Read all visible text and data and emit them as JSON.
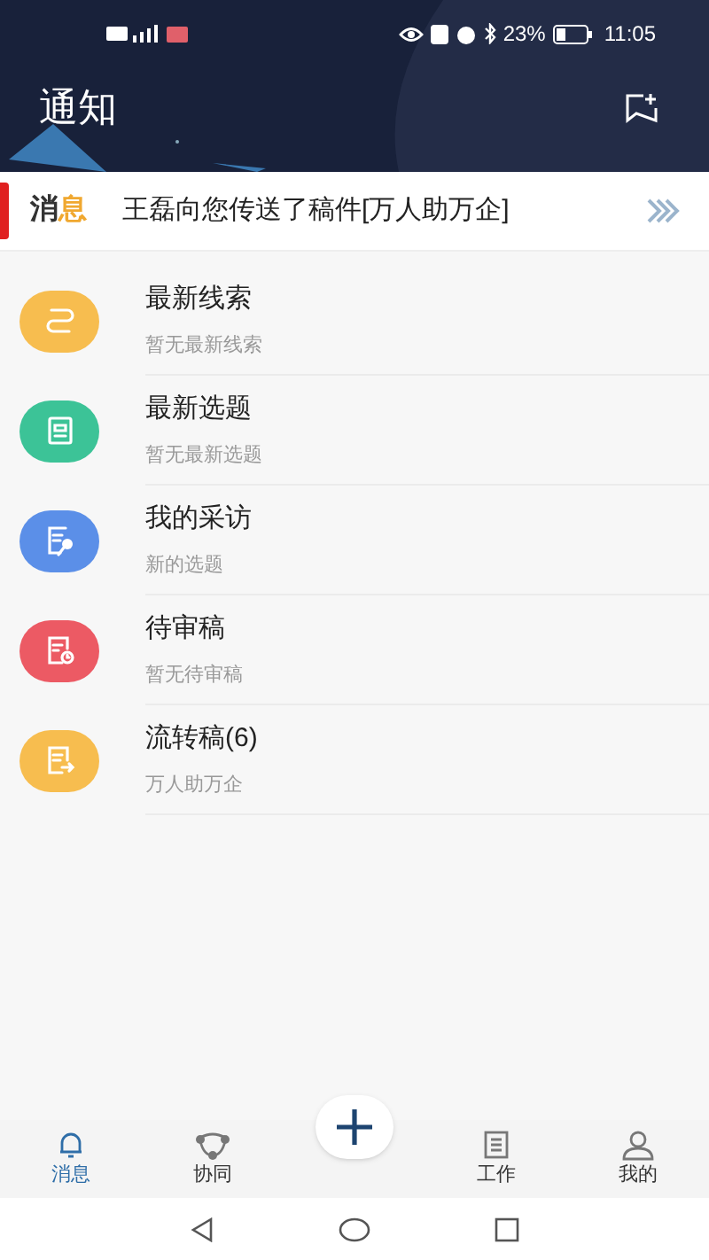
{
  "status_bar": {
    "battery_percent": "23%",
    "time": "11:05"
  },
  "header": {
    "title": "通知"
  },
  "banner": {
    "label_dark": "消",
    "label_accent": "息",
    "message": "王磊向您传送了稿件[万人助万企]"
  },
  "items": [
    {
      "kind": "clue",
      "color": "#f7bd4f",
      "title": "最新线索",
      "subtitle": "暂无最新线索"
    },
    {
      "kind": "topic",
      "color": "#3cc397",
      "title": "最新选题",
      "subtitle": "暂无最新选题"
    },
    {
      "kind": "interview",
      "color": "#5b8fe8",
      "title": "我的采访",
      "subtitle": "新的选题"
    },
    {
      "kind": "review",
      "color": "#ec5a64",
      "title": "待审稿",
      "subtitle": "暂无待审稿"
    },
    {
      "kind": "transfer",
      "color": "#f7bd4f",
      "title": "流转稿(6)",
      "subtitle": "万人助万企"
    }
  ],
  "tabs": [
    {
      "kind": "bell",
      "label": "消息",
      "selected": true
    },
    {
      "kind": "collab",
      "label": "协同",
      "selected": false
    },
    {
      "kind": "work",
      "label": "工作",
      "selected": false
    },
    {
      "kind": "user",
      "label": "我的",
      "selected": false
    }
  ]
}
